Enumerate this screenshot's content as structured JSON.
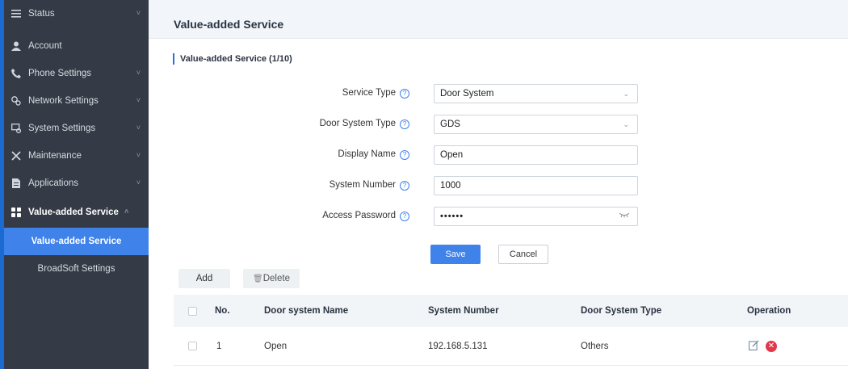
{
  "sidebar": {
    "items": [
      {
        "label": "Status",
        "icon": "list-icon",
        "chevron": "˅"
      },
      {
        "label": "Account",
        "icon": "person-icon"
      },
      {
        "label": "Phone Settings",
        "icon": "phone-icon",
        "chevron": "˅"
      },
      {
        "label": "Network Settings",
        "icon": "network-icon",
        "chevron": "˅"
      },
      {
        "label": "System Settings",
        "icon": "system-icon",
        "chevron": "˅"
      },
      {
        "label": "Maintenance",
        "icon": "tools-icon",
        "chevron": "˅"
      },
      {
        "label": "Applications",
        "icon": "document-icon",
        "chevron": "˅"
      },
      {
        "label": "Value-added Service",
        "icon": "grid-icon",
        "chevron": "˄"
      }
    ],
    "subitems": [
      {
        "label": "Value-added Service"
      },
      {
        "label": "BroadSoft Settings"
      }
    ]
  },
  "header": {
    "title": "Value-added Service"
  },
  "section": {
    "title": "Value-added Service (1/10)"
  },
  "form": {
    "service_type": {
      "label": "Service Type",
      "value": "Door System"
    },
    "door_system_type": {
      "label": "Door System Type",
      "value": "GDS"
    },
    "display_name": {
      "label": "Display Name",
      "value": "Open"
    },
    "system_number": {
      "label": "System Number",
      "value": "1000"
    },
    "access_password": {
      "label": "Access Password",
      "value": "••••••"
    },
    "help_glyph": "?",
    "save_label": "Save",
    "cancel_label": "Cancel"
  },
  "toolbar": {
    "add_label": "Add",
    "delete_label": "Delete",
    "delete_icon": "🗑"
  },
  "table": {
    "columns": [
      "No.",
      "Door system Name",
      "System Number",
      "Door System Type",
      "Operation"
    ],
    "rows": [
      {
        "no": "1",
        "name": "Open",
        "number": "192.168.5.131",
        "type": "Others"
      }
    ]
  },
  "colors": {
    "accent": "#3f82e9",
    "sidebar_bg": "#343b46",
    "danger": "#e2384a"
  }
}
